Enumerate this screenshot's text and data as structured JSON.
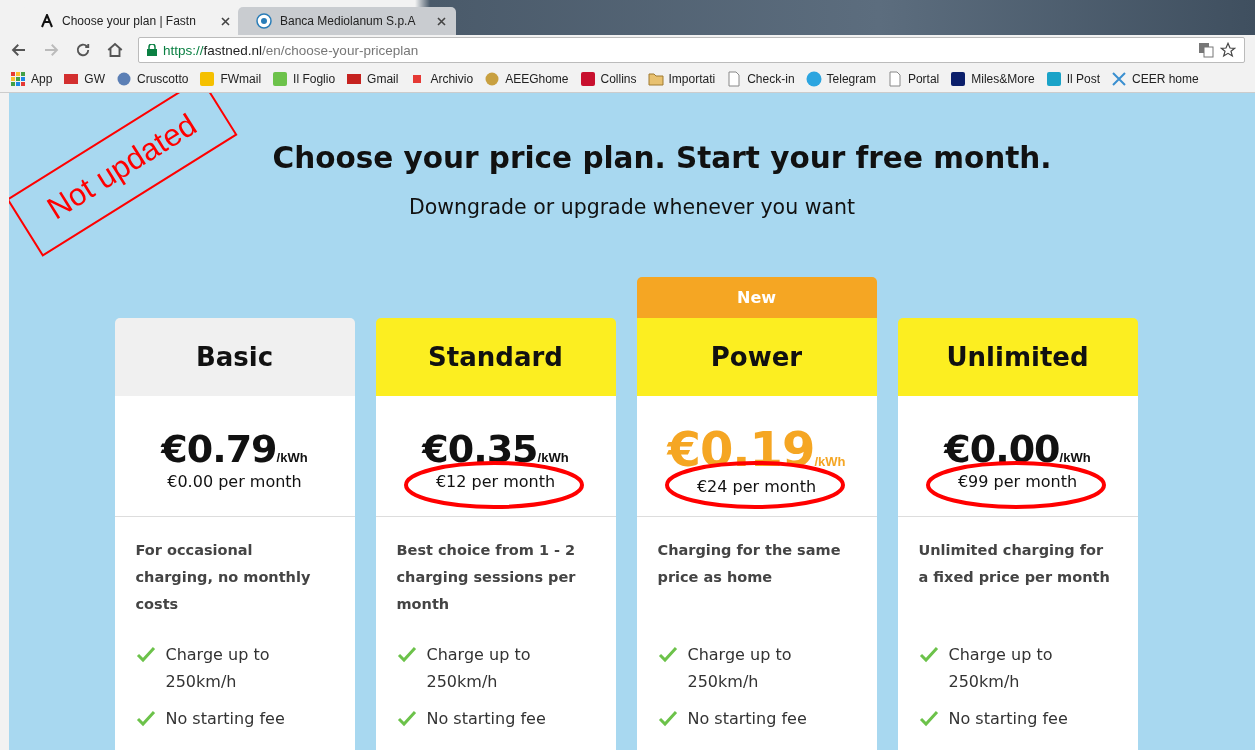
{
  "tabs": [
    {
      "title": "Choose your plan | Fastn",
      "selected": true,
      "kind": "fastned"
    },
    {
      "title": "Banca Mediolanum S.p.A",
      "selected": false,
      "kind": "bank"
    }
  ],
  "address": {
    "scheme": "https://",
    "domain": "fastned.nl",
    "path": "/en/choose-your-priceplan"
  },
  "bookmarks": [
    {
      "label": "App",
      "kind": "apps"
    },
    {
      "label": "GW",
      "kind": "mail",
      "color": "#d32f2f"
    },
    {
      "label": "Cruscotto",
      "kind": "gear",
      "color": "#5b7fb5"
    },
    {
      "label": "FWmail",
      "kind": "square",
      "color": "#f5c000"
    },
    {
      "label": "Il Foglio",
      "kind": "square",
      "color": "#6cc24a"
    },
    {
      "label": "Gmail",
      "kind": "mail",
      "color": "#c5221f"
    },
    {
      "label": "Archivio",
      "kind": "dot",
      "color": "#e53935"
    },
    {
      "label": "AEEGhome",
      "kind": "gear",
      "color": "#c8a040"
    },
    {
      "label": "Collins",
      "kind": "square",
      "color": "#c8102e"
    },
    {
      "label": "Importati",
      "kind": "folder",
      "color": "#e8c170"
    },
    {
      "label": "Check-in",
      "kind": "page"
    },
    {
      "label": "Telegram",
      "kind": "telegram",
      "color": "#2ca5e0"
    },
    {
      "label": "Portal",
      "kind": "page"
    },
    {
      "label": "Miles&More",
      "kind": "square",
      "color": "#0b1f6b"
    },
    {
      "label": "Il Post",
      "kind": "square",
      "color": "#1aa3c8"
    },
    {
      "label": "CEER home",
      "kind": "cross",
      "color": "#3a8fd0"
    }
  ],
  "stamp": "Not updated",
  "heading": "Choose your price plan. Start your free month.",
  "subheading": "Downgrade or upgrade whenever you want",
  "plans": [
    {
      "name": "Basic",
      "highlighted": false,
      "price": "€0.79",
      "unit": "/kWh",
      "per_month": "€0.00 per month",
      "circled": false,
      "featured": false,
      "description": "For occasional charging, no monthly costs",
      "features": [
        "Charge up to 250km/h",
        "No starting fee"
      ]
    },
    {
      "name": "Standard",
      "highlighted": true,
      "price": "€0.35",
      "unit": "/kWh",
      "per_month": "€12 per month",
      "circled": true,
      "featured": false,
      "description": "Best choice from 1 - 2 charging sessions per month",
      "features": [
        "Charge up to 250km/h",
        "No starting fee"
      ]
    },
    {
      "name": "Power",
      "highlighted": true,
      "badge": "New",
      "price": "€0.19",
      "unit": "/kWh",
      "per_month": "€24 per month",
      "circled": true,
      "featured": true,
      "description": "Charging for the same price as home",
      "features": [
        "Charge up to 250km/h",
        "No starting fee"
      ]
    },
    {
      "name": "Unlimited",
      "highlighted": true,
      "price": "€0.00",
      "unit": "/kWh",
      "per_month": "€99 per month",
      "circled": true,
      "featured": false,
      "description": "Unlimited charging for a fixed price per month",
      "features": [
        "Charge up to 250km/h",
        "No starting fee"
      ]
    }
  ]
}
